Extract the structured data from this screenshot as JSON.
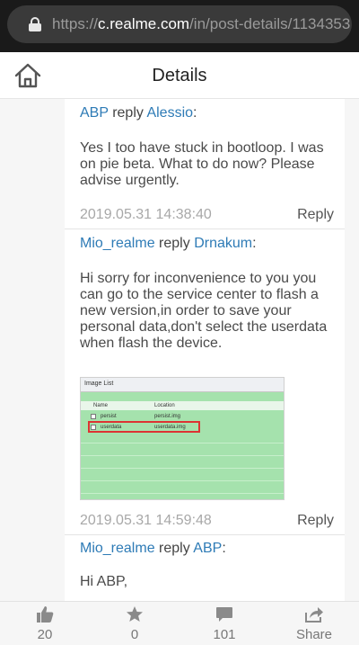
{
  "browser": {
    "url_prefix": "https://",
    "url_host": "c.realme.com",
    "url_path": "/in/post-details/1134353"
  },
  "header": {
    "title": "Details"
  },
  "replies": [
    {
      "user": "ABP",
      "verb": "reply",
      "target": "Alessio",
      "colon": ":",
      "body": "Yes I too have stuck in bootloop. I was on pie beta. What to do now? Please advise urgently.",
      "time": "2019.05.31 14:38:40",
      "reply_label": "Reply"
    },
    {
      "user": "Mio_realme",
      "verb": "reply",
      "target": "Drnakum",
      "colon": ":",
      "body": "Hi sorry for inconvenience to you you can go to the service center to flash a new version,in order to save your personal data,don't select the userdata when flash the device.",
      "image": {
        "window_title": "Image List",
        "col_name": "Name",
        "col_location": "Location",
        "rows": [
          {
            "name": "persist",
            "location": "persist.img"
          },
          {
            "name": "userdata",
            "location": "userdata.img"
          }
        ]
      },
      "time": "2019.05.31 14:59:48",
      "reply_label": "Reply"
    },
    {
      "user": "Mio_realme",
      "verb": "reply",
      "target": "ABP",
      "colon": ":",
      "body": "Hi ABP,"
    }
  ],
  "bottom": {
    "likes": "20",
    "favorites": "0",
    "comments": "101",
    "share": "Share"
  },
  "colors": {
    "link": "#2e7bb6",
    "timestamp": "#a8a8a8",
    "icon": "#8a8a8a"
  },
  "icons": [
    "lock-icon",
    "home-icon",
    "thumbs-up-icon",
    "star-icon",
    "comment-icon",
    "share-icon"
  ]
}
